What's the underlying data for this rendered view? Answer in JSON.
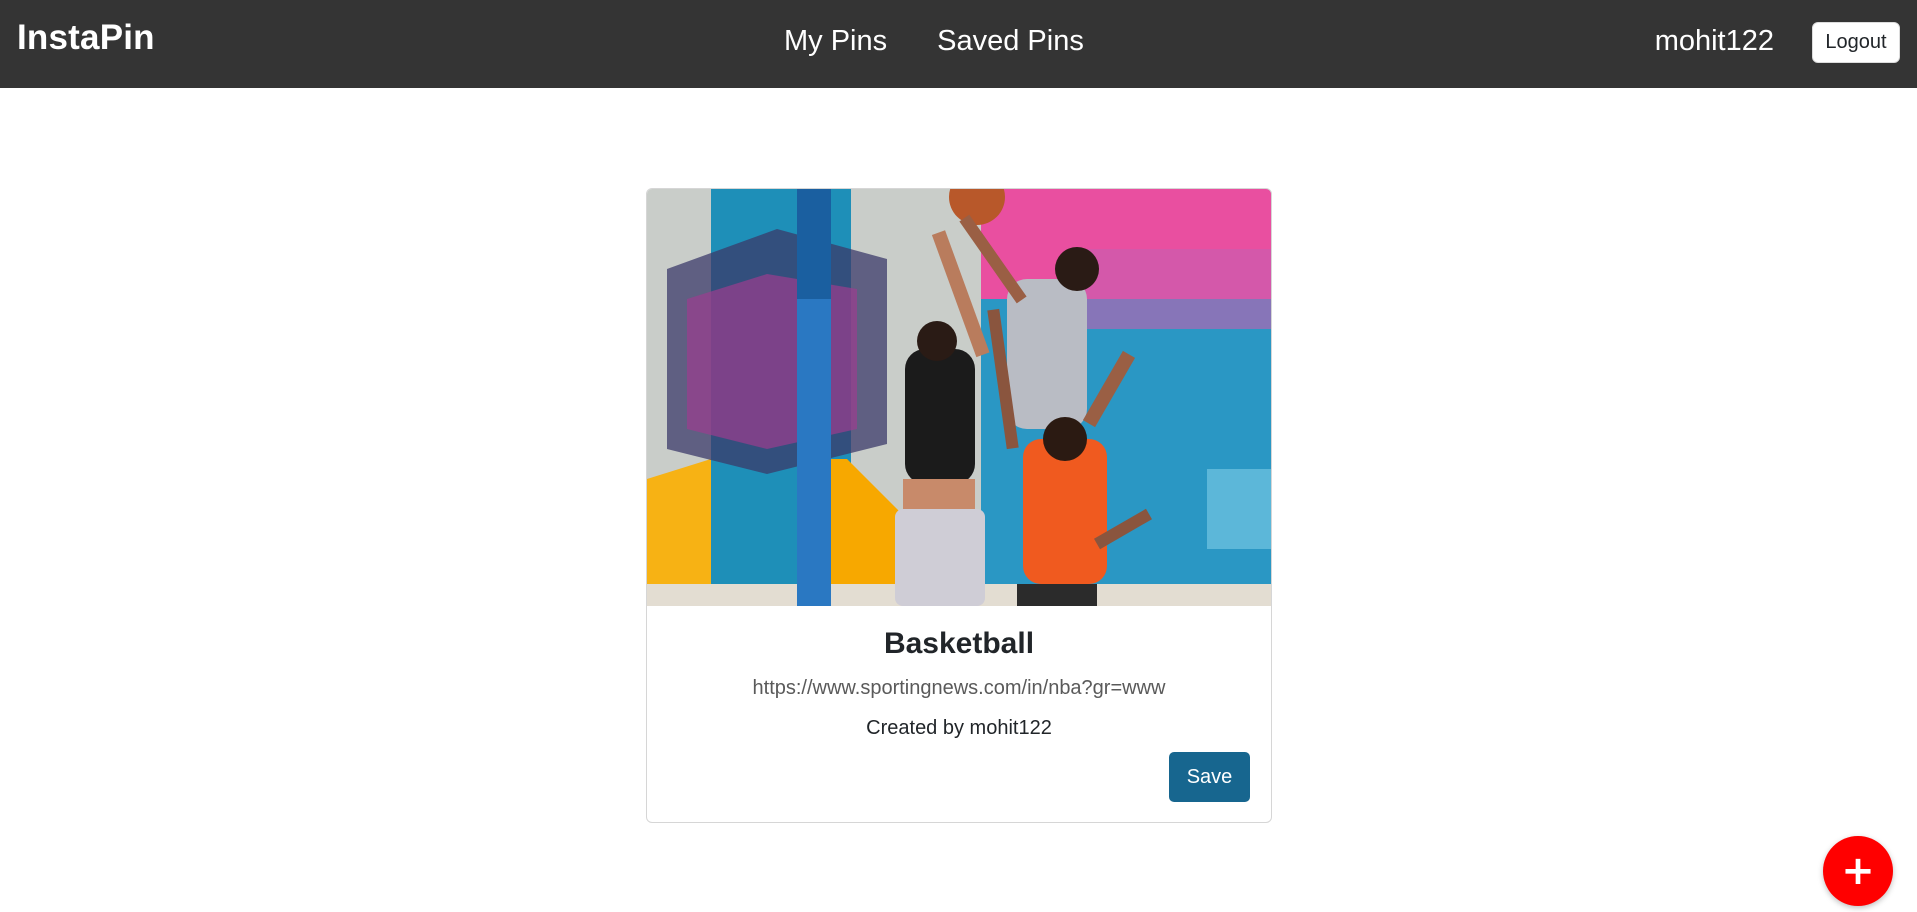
{
  "navbar": {
    "brand": "InstaPin",
    "links": [
      {
        "label": "My Pins"
      },
      {
        "label": "Saved Pins"
      }
    ],
    "username": "mohit122",
    "logout_label": "Logout"
  },
  "pin": {
    "title": "Basketball",
    "url": "https://www.sportingnews.com/in/nba?gr=www",
    "created_by": "Created by mohit122",
    "save_label": "Save",
    "image_icon": "photo-basketball-players"
  },
  "fab": {
    "icon": "plus-icon",
    "label": "+"
  },
  "colors": {
    "navbar_bg": "#343434",
    "save_button": "#17668f",
    "fab": "#ff0000"
  }
}
